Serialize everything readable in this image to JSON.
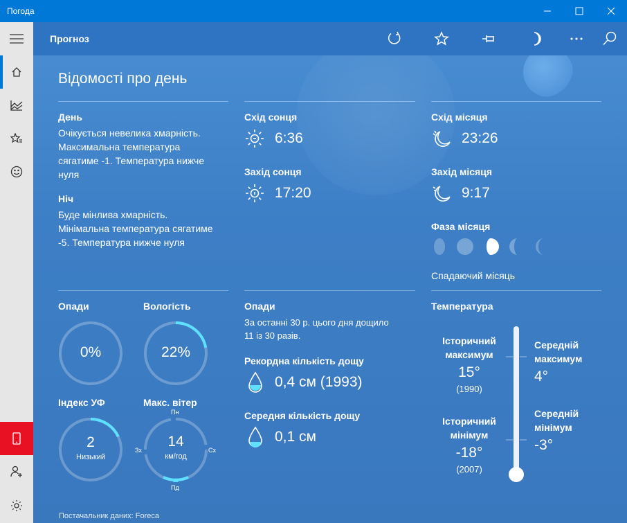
{
  "window": {
    "title": "Погода"
  },
  "topbar": {
    "title": "Прогноз"
  },
  "heading": "Відомості про день",
  "day": {
    "label": "День",
    "text": [
      "Очікується невелика хмарність.",
      "Максимальна температура",
      "сягатиме -1. Температура нижче",
      "нуля"
    ]
  },
  "night": {
    "label": "Ніч",
    "text": [
      "Буде мінлива хмарність.",
      "Мінімальна температура сягатиме",
      "-5. Температура нижче нуля"
    ]
  },
  "sun": {
    "sunrise_label": "Схід сонця",
    "sunrise": "6:36",
    "sunset_label": "Захід сонця",
    "sunset": "17:20"
  },
  "moon": {
    "moonrise_label": "Схід місяця",
    "moonrise": "23:26",
    "moonset_label": "Захід місяця",
    "moonset": "9:17",
    "phase_label": "Фаза місяця",
    "phase_name": "Спадаючий місяць"
  },
  "gauges": {
    "precip": {
      "label": "Опади",
      "value": "0%",
      "fraction": 0
    },
    "humidity": {
      "label": "Вологість",
      "value": "22%",
      "fraction": 0.22
    },
    "uv": {
      "label": "Індекс УФ",
      "value": "2",
      "sub": "Низький",
      "fraction": 0.18
    },
    "wind": {
      "label": "Макс. вітер",
      "value": "14",
      "unit": "км/год",
      "n": "Пн",
      "e": "Сх",
      "s": "Пд",
      "w": "Зх"
    }
  },
  "history": {
    "precip_label": "Опади",
    "precip_text": [
      "За останні 30 р. цього дня дощило",
      "11 із 30 разів."
    ],
    "record_label": "Рекордна кількість дощу",
    "record_value": "0,4 см (1993)",
    "avg_label": "Середня кількість дощу",
    "avg_value": "0,1 см"
  },
  "temperature": {
    "label": "Температура",
    "hist_max_title": [
      "Історичний",
      "максимум"
    ],
    "hist_max": "15°",
    "hist_max_year": "(1990)",
    "hist_min_title": [
      "Історичний",
      "мінімум"
    ],
    "hist_min": "-18°",
    "hist_min_year": "(2007)",
    "avg_max_title": [
      "Середній",
      "максимум"
    ],
    "avg_max": "4°",
    "avg_min_title": [
      "Середній",
      "мінімум"
    ],
    "avg_min": "-3°"
  },
  "credit": "Постачальник даних: Foreca",
  "icons": [
    "menu-icon",
    "home-icon",
    "chart-icon",
    "favorites-icon",
    "smiley-icon",
    "phone-icon",
    "add-user-icon",
    "settings-icon",
    "refresh-icon",
    "star-icon",
    "pin-icon",
    "moon-icon",
    "more-icon",
    "search-icon"
  ]
}
